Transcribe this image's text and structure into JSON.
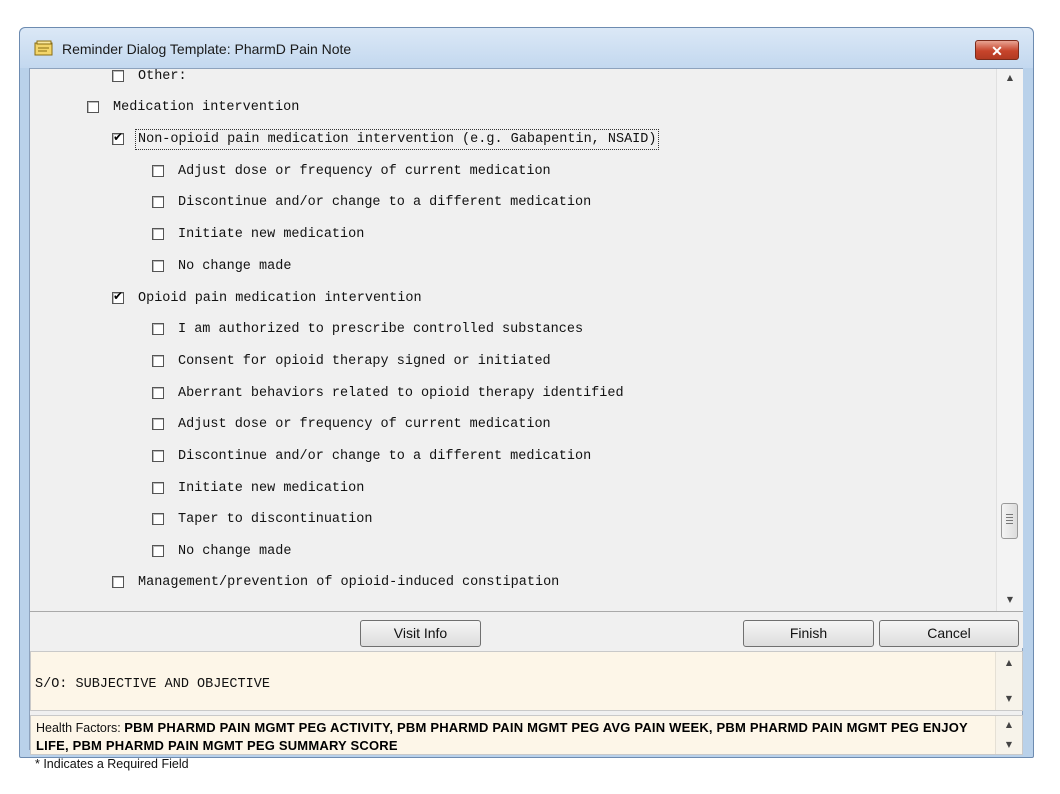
{
  "window": {
    "title": "Reminder Dialog Template: PharmD Pain Note",
    "close_label": "✕"
  },
  "tree": {
    "items": [
      {
        "label": "Other:",
        "checked": false
      },
      {
        "label": "Medication intervention",
        "checked": false
      },
      {
        "label": "Non-opioid pain medication intervention (e.g. Gabapentin, NSAID)",
        "checked": true
      },
      {
        "label": "Adjust dose or frequency of current medication",
        "checked": false
      },
      {
        "label": "Discontinue and/or change to a different medication",
        "checked": false
      },
      {
        "label": "Initiate new medication",
        "checked": false
      },
      {
        "label": "No change made",
        "checked": false
      },
      {
        "label": "Opioid pain medication intervention",
        "checked": true
      },
      {
        "label": "I am authorized to prescribe controlled substances",
        "checked": false
      },
      {
        "label": "Consent for opioid therapy signed or initiated",
        "checked": false
      },
      {
        "label": "Aberrant behaviors related to opioid therapy identified",
        "checked": false
      },
      {
        "label": "Adjust dose or frequency of current medication",
        "checked": false
      },
      {
        "label": "Discontinue and/or change to a different medication",
        "checked": false
      },
      {
        "label": "Initiate new medication",
        "checked": false
      },
      {
        "label": "Taper to discontinuation",
        "checked": false
      },
      {
        "label": "No change made",
        "checked": false
      },
      {
        "label": "Management/prevention of opioid-induced constipation",
        "checked": false
      }
    ]
  },
  "buttons": {
    "visit_info": "Visit Info",
    "finish": "Finish",
    "cancel": "Cancel"
  },
  "notes": {
    "text": "S/O: SUBJECTIVE AND OBJECTIVE"
  },
  "health_factors": {
    "label": "Health Factors:",
    "value": "PBM PHARMD PAIN MGMT PEG ACTIVITY, PBM PHARMD PAIN MGMT PEG AVG PAIN WEEK, PBM PHARMD PAIN MGMT PEG ENJOY LIFE, PBM PHARMD PAIN MGMT PEG SUMMARY SCORE"
  },
  "footer": {
    "required_note": "* Indicates a Required Field"
  },
  "colors": {
    "window_frame": "#b9d1ea",
    "notes_background": "#fdf6e8",
    "close_button": "#c7442b"
  }
}
